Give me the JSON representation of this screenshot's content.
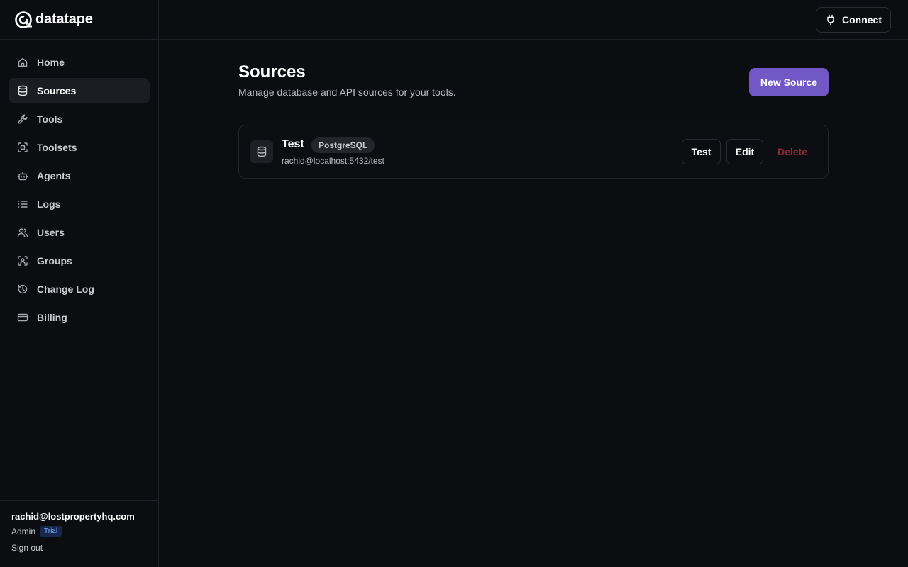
{
  "brand": {
    "name": "datatape",
    "logo_icon": "spiral-logo-icon"
  },
  "header": {
    "connect_label": "Connect",
    "connect_icon": "plug-icon"
  },
  "sidebar": {
    "items": [
      {
        "label": "Home",
        "icon": "home-icon",
        "active": false
      },
      {
        "label": "Sources",
        "icon": "database-icon",
        "active": true
      },
      {
        "label": "Tools",
        "icon": "wrench-icon",
        "active": false
      },
      {
        "label": "Toolsets",
        "icon": "scan-icon",
        "active": false
      },
      {
        "label": "Agents",
        "icon": "bot-icon",
        "active": false
      },
      {
        "label": "Logs",
        "icon": "list-icon",
        "active": false
      },
      {
        "label": "Users",
        "icon": "users-icon",
        "active": false
      },
      {
        "label": "Groups",
        "icon": "user-scan-icon",
        "active": false
      },
      {
        "label": "Change Log",
        "icon": "history-icon",
        "active": false
      },
      {
        "label": "Billing",
        "icon": "credit-card-icon",
        "active": false
      }
    ]
  },
  "user": {
    "email": "rachid@lostpropertyhq.com",
    "role": "Admin",
    "plan_badge": "Trial",
    "sign_out_label": "Sign out"
  },
  "main": {
    "title": "Sources",
    "subtitle": "Manage database and API sources for your tools.",
    "new_source_label": "New Source",
    "sources": [
      {
        "name": "Test",
        "type": "PostgreSQL",
        "connection": "rachid@localhost:5432/test",
        "actions": {
          "test": "Test",
          "edit": "Edit",
          "delete": "Delete"
        }
      }
    ]
  },
  "colors": {
    "background": "#0c0d10",
    "accent": "#7257c6",
    "danger": "#8a2a36",
    "trial_badge_text": "#7fa6ff"
  }
}
